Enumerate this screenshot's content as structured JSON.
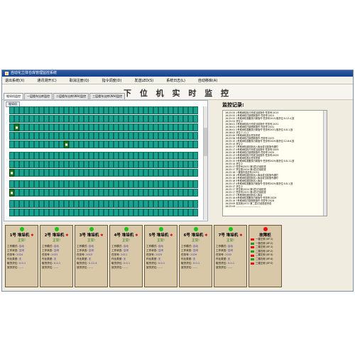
{
  "window": {
    "title": "自动化立体仓库管理监控系统"
  },
  "menu": [
    "退出系统(X)",
    "通讯测开(C)",
    "取消注册(Q)",
    "指令调度(D)",
    "发送LED(S)",
    "系统日志(L)",
    "自动移库(A)"
  ],
  "page_title": "下 位 机 实 时 监 控",
  "tabs": [
    "堆垛机监控",
    "一层楼车出库监控",
    "二层楼车出库(WH)监控",
    "三层楼车出库(WH)监控"
  ],
  "grid": {
    "tab_label": "堆垛机"
  },
  "log": {
    "title": "监控记录:",
    "lines": [
      "16:25:55 1号堆垛机执行完成当前指令 任务号:2015",
      "16:25:55 1号堆垛机已接受新指令 任务号:2015",
      "16:25:55 1号堆垛机准备执行新指令 任务号2015,取货位:0-12-4,放",
      "16:25:54 货位:2",
      "16:26:01 3号堆垛机执行完成当前指令 任务号:2031",
      "16:26:01 2号堆垛机已接受新指令 任务号:2031",
      "16:26:01 2号堆垛机准备执行新指令 任务号2031,取货位:0-8-1,放",
      "16:26:02 货位:7-11-1",
      "16:25:49 3号堆垛机发出任务完成",
      "16:25:58 3号堆垛机已接受新指令 任务号:2033",
      "16:25:15 1号堆垛机准备执行新指令 任务号2029,取货位:12-8-6,放",
      "16:25:14 货位:2",
      "16:25:17 1号堆垛机返回到出入库台或当前指令超时",
      "16:25:17 4号堆垛机执行完成当前指令 任务号:2009",
      "16:25:16 5号堆垛机已接受新指令 任务号:2029",
      "16:25:13 5号堆垛机执行完成当前指令 任务号:2029",
      "16:25:14 6号堆垛机发出任务完成",
      "16:25:15 5号堆垛机准备执行新指令 任务号2029,取货位:0-8-11,放",
      "16:25:14 货位:2",
      "16:25:17 任务号(2031 第2层)已经检查",
      "16:25:17 货位需(2024 第2层)已经检查",
      "16:25:16 一楼指令发送号(2031)",
      "16:25:18 1号堆垛机返回到出入库台或当前指令超时",
      "16:25:18 2号堆垛机返回到出入库台或当前指令超时",
      "16:25:18 5号堆垛机返回到出入库台",
      "16:25:17 4号堆垛机准备执行新指令 任务号2029,取货位:0-8-1,放",
      "16:25:17 货位:2",
      "16:25:17 货位需(2024 第2层)已经检查",
      "16:25:17 任务号(2031 第2层)已经检查",
      "16:25:17 1号堆垛机返回到出入库台",
      "16:25:18 6号堆垛机准备执行新指令 任务号:2029",
      "16:25:19 7号堆垛机已接受新指令 任务号:2028",
      "16:25:09 发送到(2011 第二层)已经检查完成",
      "16:25:09 ------------------------------"
    ]
  },
  "stackers": [
    {
      "name": "1号 堆垛机",
      "state": "正常!",
      "mode_label": "工作模式:",
      "mode": "自动",
      "status_label": "工作状态:",
      "status": "空闲",
      "task_label": "任务号:",
      "task": "2024",
      "op_label": "作业类型:",
      "op": "无",
      "pick_label": "取货货位:",
      "pick": "0-0-1",
      "put_label": "放货货位:",
      "put": "-----"
    },
    {
      "name": "2号 堆垛机",
      "state": "正常!",
      "mode_label": "工作模式:",
      "mode": "自动",
      "status_label": "工作状态:",
      "status": "空闲",
      "task_label": "任务号:",
      "task": "2031",
      "op_label": "作业类型:",
      "op": "无",
      "pick_label": "取货货位:",
      "pick": "0-0-1",
      "put_label": "放货货位:",
      "put": "-----"
    },
    {
      "name": "3号 堆垛机",
      "state": "正常!",
      "mode_label": "工作模式:",
      "mode": "自动",
      "status_label": "工作状态:",
      "status": "空闲",
      "task_label": "任务号:",
      "task": "2015",
      "op_label": "作业类型:",
      "op": "无",
      "pick_label": "取货货位:",
      "pick": "0-12-4",
      "put_label": "放货货位:",
      "put": "-----"
    },
    {
      "name": "4号 堆垛机",
      "state": "正常!",
      "mode_label": "工作模式:",
      "mode": "自动",
      "status_label": "工作状态:",
      "status": "空闲",
      "task_label": "任务号:",
      "task": "2011",
      "op_label": "作业类型:",
      "op": "无",
      "pick_label": "取货货位:",
      "pick": "0-0-1",
      "put_label": "放货货位:",
      "put": "-----"
    },
    {
      "name": "5号 堆垛机",
      "state": "正常!",
      "mode_label": "工作模式:",
      "mode": "自动",
      "status_label": "工作状态:",
      "status": "空闲",
      "task_label": "任务号:",
      "task": "2023",
      "op_label": "作业类型:",
      "op": "无",
      "pick_label": "取货货位:",
      "pick": "0-0-1",
      "put_label": "放货货位:",
      "put": "-----"
    },
    {
      "name": "6号 堆垛机",
      "state": "正常!",
      "mode_label": "工作模式:",
      "mode": "自动",
      "status_label": "工作状态:",
      "status": "空闲",
      "task_label": "任务号:",
      "task": "2029",
      "op_label": "作业类型:",
      "op": "无",
      "pick_label": "取货货位:",
      "pick": "0-0-1",
      "put_label": "放货货位:",
      "put": "-----"
    },
    {
      "name": "7号 堆垛机",
      "state": "正常!",
      "mode_label": "工作模式:",
      "mode": "自动",
      "status_label": "工作状态:",
      "status": "空闲",
      "task_label": "任务号:",
      "task": "2032",
      "op_label": "作业类型:",
      "op": "无",
      "pick_label": "取货货位:",
      "pick": "0-0-1",
      "put_label": "放货货位:",
      "put": "-----"
    }
  ],
  "alarm_card": {
    "name": "故障柜",
    "lines": [
      "一楼左侧 (0F:1)",
      "一楼右侧 (0F:2)",
      "二楼左侧 (0F:1)",
      "二楼右侧 (0F:2)",
      "二楼左侧 (0F:3)",
      "二楼右侧 (0F:4)",
      "三楼左侧 (0F:5)"
    ]
  }
}
